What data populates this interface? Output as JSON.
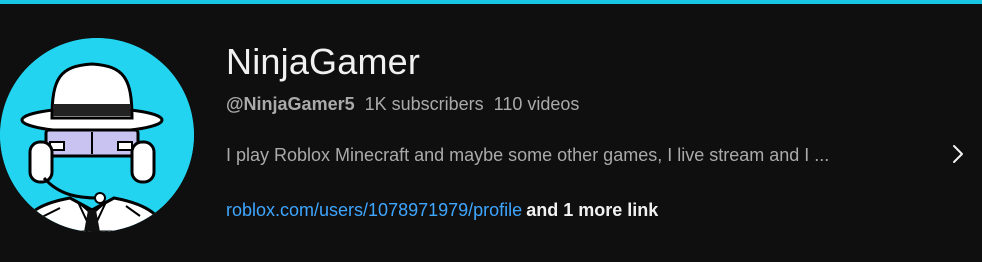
{
  "channel": {
    "name": "NinjaGamer",
    "handle": "@NinjaGamer5",
    "subscribers": "1K subscribers",
    "videos": "110 videos",
    "description": "I play Roblox Minecraft and maybe some other games, I live stream and I ...",
    "link_text": "roblox.com/users/1078971979/profile",
    "more_links": "and 1 more link"
  },
  "icons": {
    "avatar": "ninja-avatar",
    "description_expand": "chevron-right-icon"
  },
  "colors": {
    "accent_bar": "#18c6e6",
    "background": "#0f0f0f",
    "link": "#3ea6ff",
    "avatar_bg": "#22d4f0"
  }
}
